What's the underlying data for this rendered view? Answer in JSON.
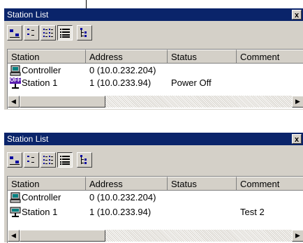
{
  "panels": [
    {
      "title": "Station List",
      "close_glyph": "x",
      "columns": [
        "Station",
        "Address",
        "Status",
        "Comment"
      ],
      "rows": [
        {
          "icon": "controller-icon",
          "station": "Controller",
          "address": "0 (10.0.232.204)",
          "status": "",
          "comment": ""
        },
        {
          "icon": "off-station-icon",
          "station": "Station 1",
          "address": "1 (10.0.233.94)",
          "status": "Power Off",
          "comment": ""
        }
      ],
      "toolbar_buttons": [
        "large-icons-icon",
        "small-icons-icon",
        "list-view-icon",
        "details-view-icon",
        "tree-view-icon"
      ],
      "pressed_button": "details-view-icon",
      "off_badge": "OFF"
    },
    {
      "title": "Station List",
      "close_glyph": "x",
      "columns": [
        "Station",
        "Address",
        "Status",
        "Comment"
      ],
      "rows": [
        {
          "icon": "controller-icon",
          "station": "Controller",
          "address": "0 (10.0.232.204)",
          "status": "",
          "comment": ""
        },
        {
          "icon": "station-icon",
          "station": "Station 1",
          "address": "1 (10.0.233.94)",
          "status": "",
          "comment": "Test 2"
        }
      ],
      "toolbar_buttons": [
        "large-icons-icon",
        "small-icons-icon",
        "list-view-icon",
        "details-view-icon",
        "tree-view-icon"
      ],
      "pressed_button": "details-view-icon"
    }
  ],
  "colors": {
    "titlebar": "#0a246a",
    "face": "#d4d0c8",
    "off_badge": "#5a1fb0"
  },
  "scrollbar": {
    "left_arrow": "◀",
    "right_arrow": "▶"
  }
}
